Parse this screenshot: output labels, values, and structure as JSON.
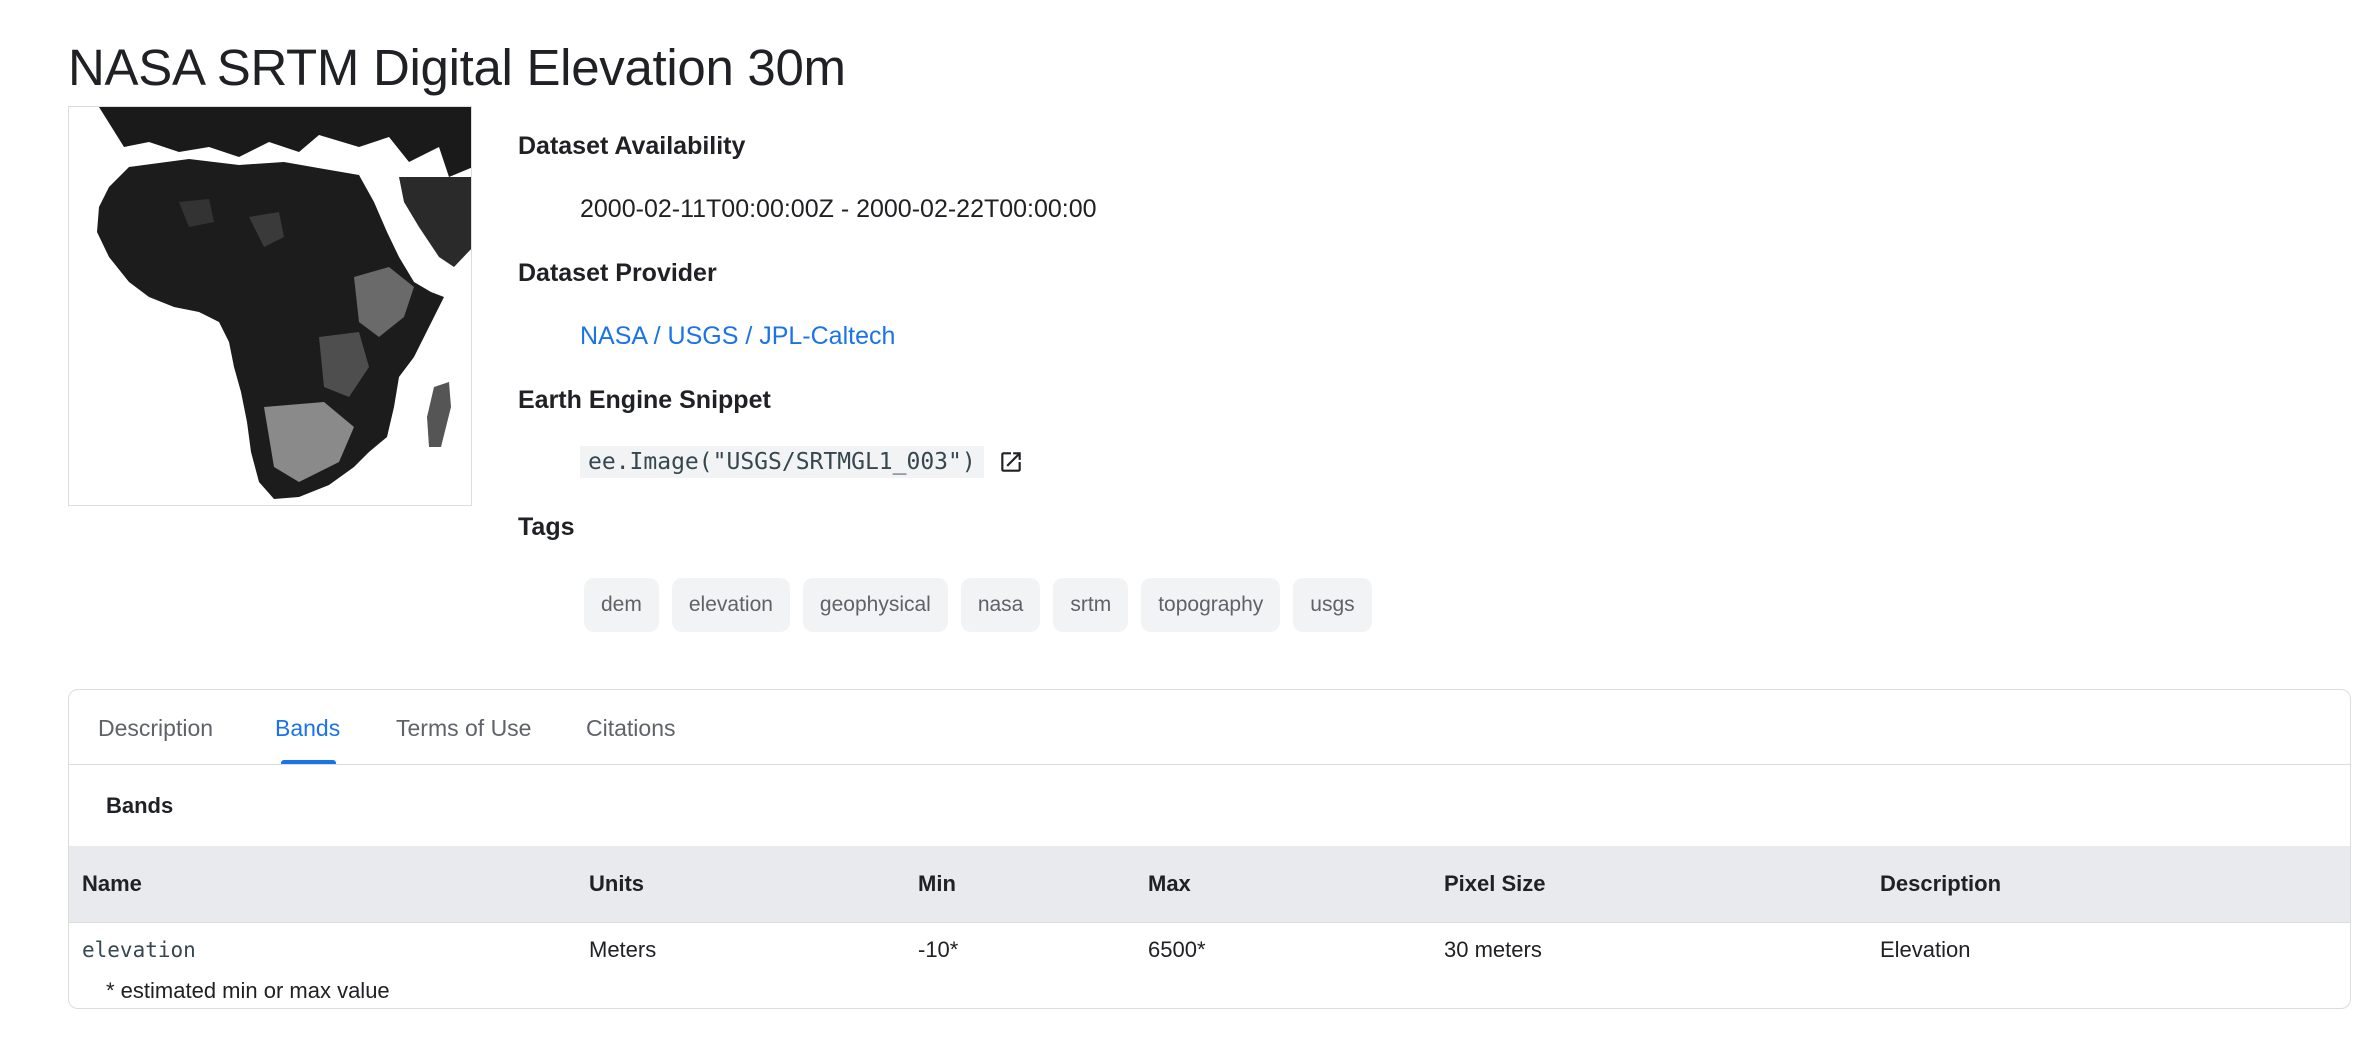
{
  "page": {
    "title": "NASA SRTM Digital Elevation 30m"
  },
  "meta": {
    "availability_label": "Dataset Availability",
    "availability_value": "2000-02-11T00:00:00Z - 2000-02-22T00:00:00",
    "provider_label": "Dataset Provider",
    "provider_value": "NASA / USGS / JPL-Caltech",
    "snippet_label": "Earth Engine Snippet",
    "snippet_code": "ee.Image(\"USGS/SRTMGL1_003\")",
    "snippet_icon": "open-in-new-icon",
    "tags_label": "Tags",
    "tags": [
      "dem",
      "elevation",
      "geophysical",
      "nasa",
      "srtm",
      "topography",
      "usgs"
    ]
  },
  "tabs": [
    {
      "label": "Description",
      "active": false
    },
    {
      "label": "Bands",
      "active": true
    },
    {
      "label": "Terms of Use",
      "active": false
    },
    {
      "label": "Citations",
      "active": false
    }
  ],
  "bands": {
    "section_title": "Bands",
    "columns": [
      "Name",
      "Units",
      "Min",
      "Max",
      "Pixel Size",
      "Description"
    ],
    "rows": [
      [
        "elevation",
        "Meters",
        "-10*",
        "6500*",
        "30 meters",
        "Elevation"
      ]
    ],
    "footnote": "* estimated min or max value"
  },
  "colors": {
    "accent": "#1a73e8",
    "text": "#202124",
    "chip_bg": "#f1f3f4",
    "header_bg": "#e8eaed"
  }
}
